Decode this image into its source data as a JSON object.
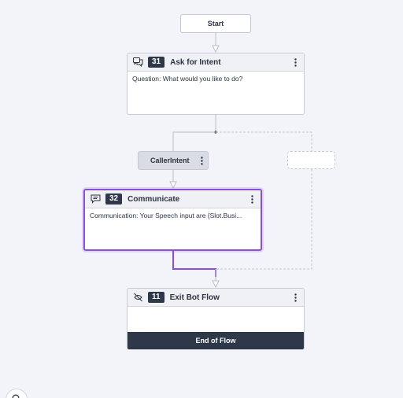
{
  "start": {
    "label": "Start"
  },
  "nodes": {
    "ask": {
      "number": "31",
      "title": "Ask for Intent",
      "body": "Question: What would you like to do?",
      "icon": "chat-bubbles-icon"
    },
    "communicate": {
      "number": "32",
      "title": "Communicate",
      "body": "Communication: Your Speech input are {Slot.Busi...",
      "icon": "message-icon"
    },
    "exit": {
      "number": "11",
      "title": "Exit Bot Flow",
      "body": "",
      "footer": "End of Flow",
      "icon": "exit-flow-icon"
    }
  },
  "branches": [
    {
      "label": "CallerIntent"
    },
    {
      "label": ""
    }
  ],
  "colors": {
    "canvas": "#f3f4f9",
    "selected_border": "#8a4fd6",
    "badge": "#2e3848",
    "connector": "#b9bdc7"
  },
  "controls": {
    "zoom_icon": "search-icon"
  }
}
